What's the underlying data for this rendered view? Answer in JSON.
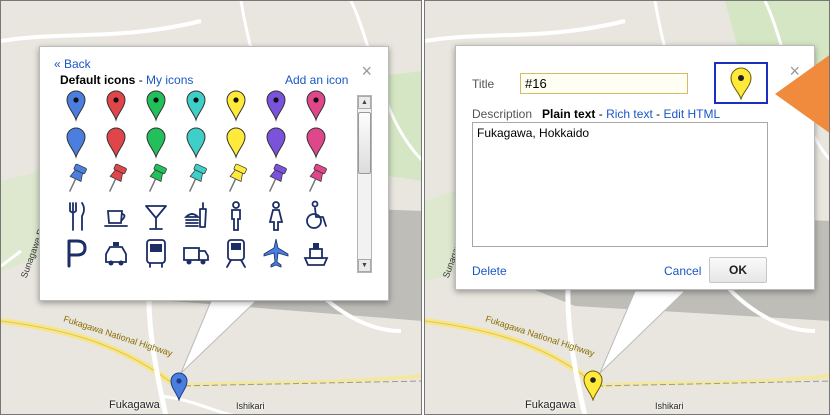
{
  "left_panel": {
    "back_link": "« Back",
    "close_glyph": "×",
    "tab_default_icons": "Default icons",
    "tab_separator": "-",
    "tab_my_icons": "My icons",
    "add_icon_link": "Add an icon",
    "icon_rows": [
      [
        "blue-dot-pin-icon",
        "red-dot-pin-icon",
        "green-dot-pin-icon",
        "cyan-dot-pin-icon",
        "yellow-dot-pin-icon",
        "purple-dot-pin-icon",
        "pink-dot-pin-icon"
      ],
      [
        "blue-pin-icon",
        "red-pin-icon",
        "green-pin-icon",
        "cyan-pin-icon",
        "yellow-pin-icon",
        "purple-pin-icon",
        "pink-pin-icon"
      ],
      [
        "blue-pushpin-icon",
        "red-pushpin-icon",
        "green-pushpin-icon",
        "cyan-pushpin-icon",
        "yellow-pushpin-icon",
        "purple-pushpin-icon",
        "pink-pushpin-icon"
      ],
      [
        "restaurant-icon",
        "cafe-icon",
        "bar-icon",
        "fast-food-icon",
        "man-icon",
        "woman-icon",
        "wheelchair-icon"
      ],
      [
        "parking-icon",
        "taxi-icon",
        "bus-icon",
        "truck-icon",
        "rail-icon",
        "airport-icon",
        "ferry-icon"
      ]
    ],
    "map_labels": {
      "town": "Fukagawa",
      "town2": "Ishikari",
      "road1": "Fukagawa National Highway",
      "road2": "Sunagawa Rd"
    }
  },
  "right_panel": {
    "close_glyph": "×",
    "title_label": "Title",
    "title_value": "#16",
    "description_label": "Description",
    "mode_plain": "Plain text",
    "mode_rich": "Rich text",
    "mode_html": "Edit HTML",
    "mode_separator": "-",
    "description_value": "Fukagawa, Hokkaido",
    "delete_link": "Delete",
    "cancel_link": "Cancel",
    "ok_button": "OK",
    "selected_icon": "yellow-dot-pin-icon",
    "map_labels": {
      "town": "Fukagawa",
      "town2": "Ishikari",
      "road1": "Fukagawa National Highway",
      "road2": "Sunagawa Rd"
    }
  },
  "colors": {
    "blue": "#4a7fe0",
    "red": "#e0454a",
    "green": "#22c05a",
    "cyan": "#3ed0c8",
    "yellow": "#ffe93a",
    "purple": "#7a52dc",
    "pink": "#e0478a",
    "arrow": "#f08a3c",
    "highlight": "#1a2fc0",
    "link": "#1a57c6"
  }
}
